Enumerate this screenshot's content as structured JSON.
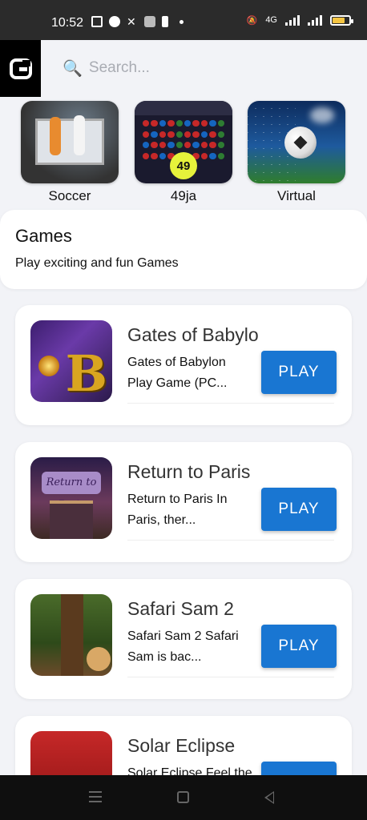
{
  "status_bar": {
    "time": "10:52",
    "network": "4G",
    "battery_fraction": 0.75,
    "icons": [
      "msg-icon",
      "facebook-icon",
      "x-icon",
      "camera-icon",
      "lock-icon",
      "dot-icon",
      "mute-icon",
      "signal-icon",
      "signal-icon",
      "battery-icon"
    ]
  },
  "header": {
    "search_placeholder": "Search...",
    "logo_icon": "app-logo-icon"
  },
  "categories": [
    {
      "label": "Soccer"
    },
    {
      "label": "49ja",
      "badge": "49"
    },
    {
      "label": "Virtual"
    }
  ],
  "games_section": {
    "title": "Games",
    "subtitle": "Play exciting and fun Games"
  },
  "games": [
    {
      "title": "Gates of Babylo",
      "desc_line1": "Gates of Babylon",
      "desc_line2": "Play Game (PC...",
      "play_label": "PLAY"
    },
    {
      "title": "Return to Paris",
      "desc_line1": "Return to Paris In",
      "desc_line2": "Paris, ther...",
      "play_label": "PLAY",
      "thumb_text": "Return to Paris"
    },
    {
      "title": "Safari Sam 2",
      "desc_line1": "Safari Sam 2 Safari",
      "desc_line2": "Sam is bac...",
      "play_label": "PLAY"
    },
    {
      "title": "Solar Eclipse",
      "desc_line1": "Solar Eclipse Feel the",
      "desc_line2": "",
      "play_label": "PLAY"
    }
  ],
  "colors": {
    "accent": "#1976d2",
    "background": "#f2f3f7",
    "status_bar": "#2b2b2b"
  }
}
